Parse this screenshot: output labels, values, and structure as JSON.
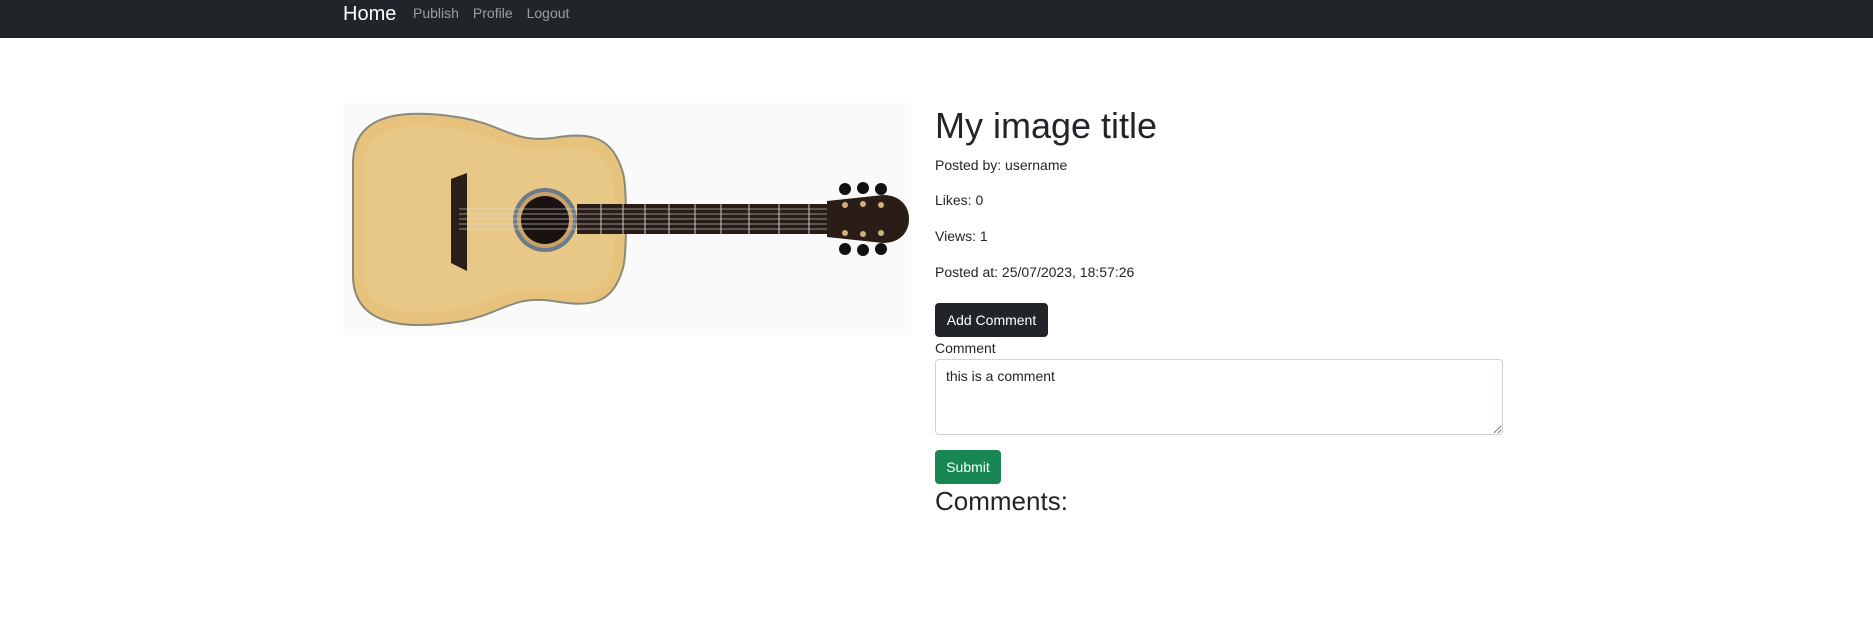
{
  "navbar": {
    "brand": "Home",
    "links": [
      "Publish",
      "Profile",
      "Logout"
    ]
  },
  "image": {
    "subject": "acoustic guitar",
    "icon": "guitar-image"
  },
  "post": {
    "title": "My image title",
    "posted_by": "Posted by: username",
    "likes": "Likes: 0",
    "views": "Views: 1",
    "posted_at": "Posted at: 25/07/2023, 18:57:26"
  },
  "comment_form": {
    "add_button_label": "Add Comment",
    "label": "Comment",
    "value": "this is a comment",
    "submit_label": "Submit"
  },
  "comments": {
    "heading": "Comments:"
  },
  "colors": {
    "navbar_bg": "#212529",
    "dark_button": "#212529",
    "success_button": "#198754"
  }
}
